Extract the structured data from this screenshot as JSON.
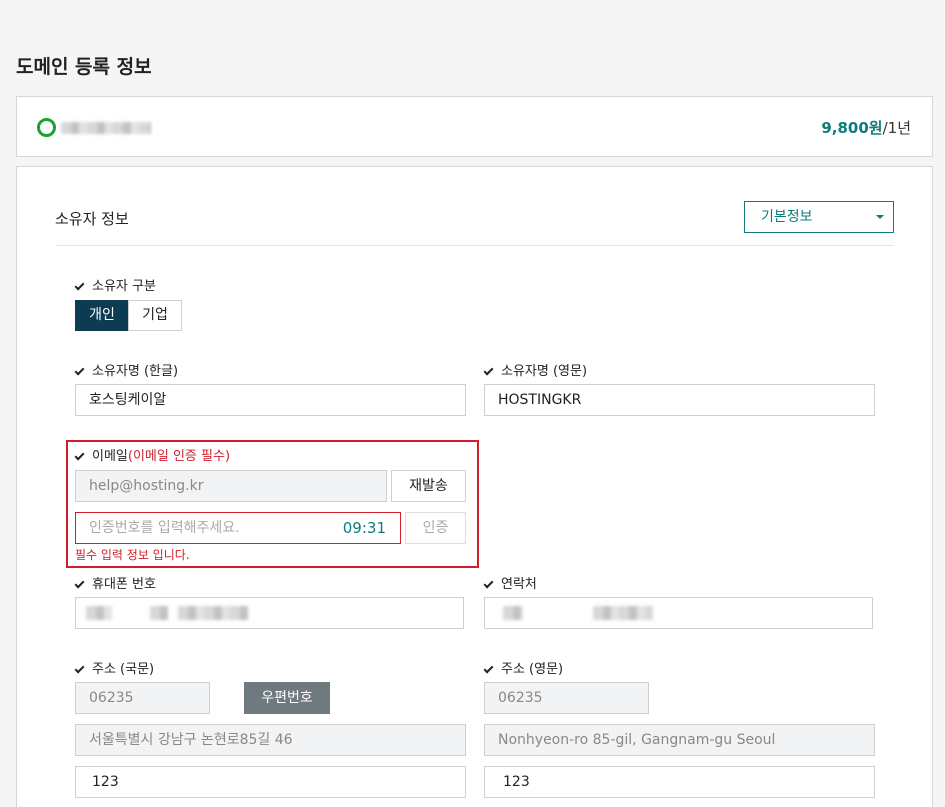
{
  "page": {
    "title": "도메인 등록 정보"
  },
  "domain": {
    "price_amount": "9,800원",
    "price_period": "/1년"
  },
  "owner_section": {
    "title": "소유자 정보",
    "select_value": "기본정보"
  },
  "owner_type": {
    "label": "소유자 구분",
    "options": [
      "개인",
      "기업"
    ],
    "selected": "개인"
  },
  "name_kr": {
    "label": "소유자명 (한글)",
    "value": "호스팅케이알"
  },
  "name_en": {
    "label": "소유자명 (영문)",
    "value": "HOSTINGKR"
  },
  "email": {
    "label": "이메일",
    "required_note": "(이메일 인증 필수)",
    "value": "help@hosting.kr",
    "resend_label": "재발송",
    "code_placeholder": "인증번호를 입력해주세요.",
    "timer": "09:31",
    "verify_label": "인증",
    "error_message": "필수 입력 정보 입니다."
  },
  "mobile": {
    "label": "휴대폰 번호"
  },
  "contact": {
    "label": "연락처"
  },
  "address_kr": {
    "label": "주소 (국문)",
    "zip": "06235",
    "zip_button": "우편번호",
    "line1": "서울특별시 강남구 논현로85길 46",
    "line2": "123"
  },
  "address_en": {
    "label": "주소 (영문)",
    "zip": "06235",
    "line1": "Nonhyeon-ro 85-gil,  Gangnam-gu Seoul",
    "line2": "123"
  }
}
